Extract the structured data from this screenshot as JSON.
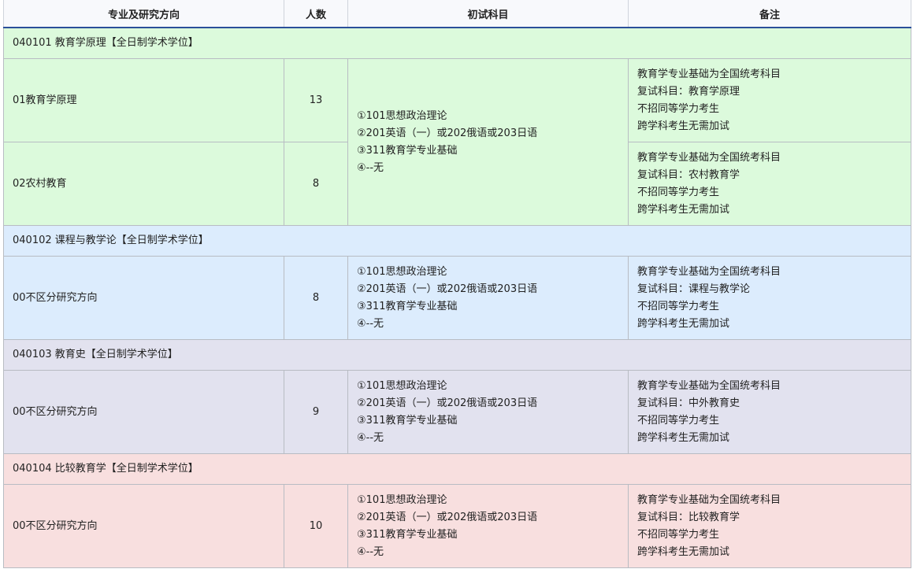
{
  "headers": [
    "专业及研究方向",
    "人数",
    "初试科目",
    "备注"
  ],
  "exam_subjects": [
    "①101思想政治理论",
    "②201英语（一）或202俄语或203日语",
    "③311教育学专业基础",
    "④--无"
  ],
  "sections": [
    {
      "title": "040101 教育学原理【全日制学术学位】",
      "bg": "#dcfadc",
      "rows": [
        {
          "direction": "01教育学原理",
          "count": "13",
          "notes": [
            "教育学专业基础为全国统考科目",
            "复试科目：教育学原理",
            "不招同等学力考生",
            "跨学科考生无需加试"
          ]
        },
        {
          "direction": "02农村教育",
          "count": "8",
          "notes": [
            "教育学专业基础为全国统考科目",
            "复试科目：农村教育学",
            "不招同等学力考生",
            "跨学科考生无需加试"
          ]
        }
      ]
    },
    {
      "title": "040102 课程与教学论【全日制学术学位】",
      "bg": "#dcecfd",
      "rows": [
        {
          "direction": "00不区分研究方向",
          "count": "8",
          "notes": [
            "教育学专业基础为全国统考科目",
            "复试科目：课程与教学论",
            "不招同等学力考生",
            "跨学科考生无需加试"
          ]
        }
      ]
    },
    {
      "title": "040103 教育史【全日制学术学位】",
      "bg": "#e2e2ef",
      "rows": [
        {
          "direction": "00不区分研究方向",
          "count": "9",
          "notes": [
            "教育学专业基础为全国统考科目",
            "复试科目：中外教育史",
            "不招同等学力考生",
            "跨学科考生无需加试"
          ]
        }
      ]
    },
    {
      "title": "040104 比较教育学【全日制学术学位】",
      "bg": "#f8dfdf",
      "rows": [
        {
          "direction": "00不区分研究方向",
          "count": "10",
          "notes": [
            "教育学专业基础为全国统考科目",
            "复试科目：比较教育学",
            "不招同等学力考生",
            "跨学科考生无需加试"
          ]
        }
      ]
    }
  ]
}
